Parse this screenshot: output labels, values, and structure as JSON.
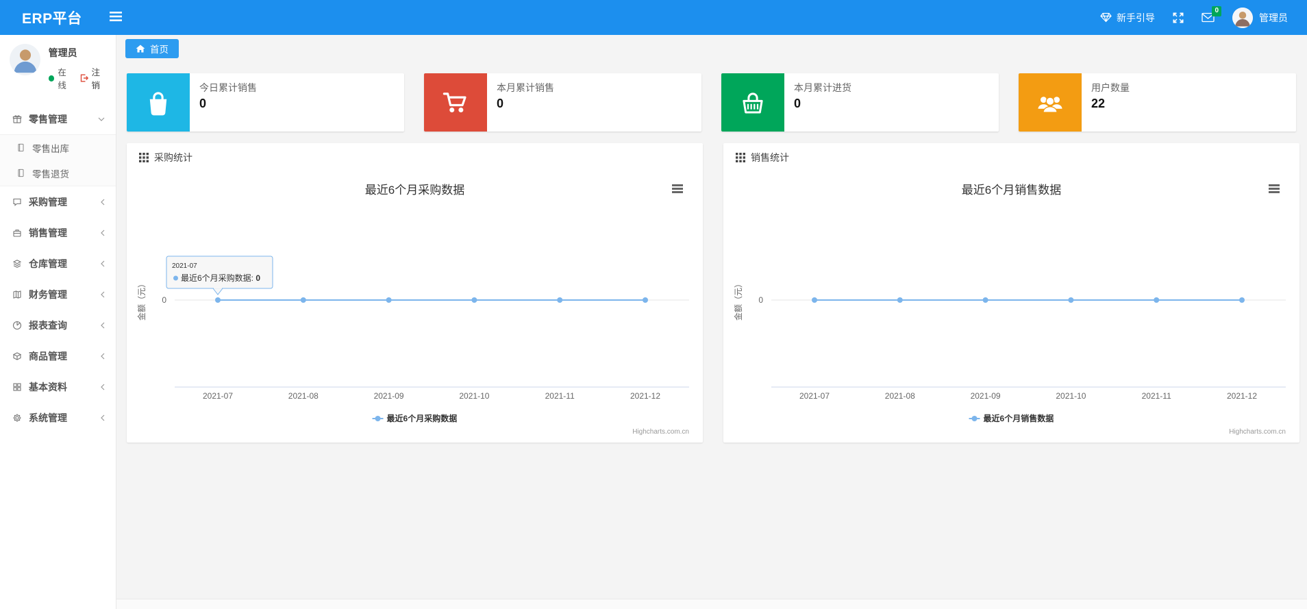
{
  "colors": {
    "navbar": "#1c8fee",
    "tab": "#2d9cf0",
    "badge": "#00a65a",
    "online": "#00a65a",
    "series": "#7cb5ec"
  },
  "navbar": {
    "brand": "ERP平台",
    "guide_label": "新手引导",
    "message_badge": "0",
    "username": "管理员"
  },
  "sidebar": {
    "user": {
      "name": "管理员",
      "status": "在线",
      "logout": "注销"
    },
    "menu": [
      {
        "label": "零售管理",
        "icon": "gift-icon",
        "expanded": true,
        "children": [
          {
            "label": "零售出库",
            "icon": "file-icon"
          },
          {
            "label": "零售退货",
            "icon": "file-icon"
          }
        ]
      },
      {
        "label": "采购管理",
        "icon": "chat-icon"
      },
      {
        "label": "销售管理",
        "icon": "briefcase-icon"
      },
      {
        "label": "仓库管理",
        "icon": "layers-icon"
      },
      {
        "label": "财务管理",
        "icon": "book-icon"
      },
      {
        "label": "报表查询",
        "icon": "pie-chart-icon"
      },
      {
        "label": "商品管理",
        "icon": "box-icon"
      },
      {
        "label": "基本资料",
        "icon": "grid-icon"
      },
      {
        "label": "系统管理",
        "icon": "gear-icon"
      }
    ]
  },
  "tabs": [
    {
      "label": "首页",
      "active": true
    }
  ],
  "stat_cards": [
    {
      "label": "今日累计销售",
      "value": "0",
      "color": "#1eb7e5",
      "icon": "bag-icon"
    },
    {
      "label": "本月累计销售",
      "value": "0",
      "color": "#dd4b39",
      "icon": "cart-icon"
    },
    {
      "label": "本月累计进货",
      "value": "0",
      "color": "#00a65a",
      "icon": "basket-icon"
    },
    {
      "label": "用户数量",
      "value": "22",
      "color": "#f39c12",
      "icon": "users-icon"
    }
  ],
  "panels": [
    {
      "header": "采购统计"
    },
    {
      "header": "销售统计"
    }
  ],
  "chart_data": [
    {
      "type": "line",
      "title": "最近6个月采购数据",
      "categories": [
        "2021-07",
        "2021-08",
        "2021-09",
        "2021-10",
        "2021-11",
        "2021-12"
      ],
      "series": [
        {
          "name": "最近6个月采购数据",
          "values": [
            0,
            0,
            0,
            0,
            0,
            0
          ],
          "color": "#7cb5ec"
        }
      ],
      "xlabel": "",
      "ylabel": "金额（元）",
      "yticks": [
        "0"
      ],
      "ylim": [
        0,
        1
      ],
      "grid": true,
      "legend_position": "bottom",
      "credits": "Highcharts.com.cn",
      "tooltip": {
        "header": "2021-07",
        "series_name": "最近6个月采购数据",
        "value": "0",
        "point_index": 0
      }
    },
    {
      "type": "line",
      "title": "最近6个月销售数据",
      "categories": [
        "2021-07",
        "2021-08",
        "2021-09",
        "2021-10",
        "2021-11",
        "2021-12"
      ],
      "series": [
        {
          "name": "最近6个月销售数据",
          "values": [
            0,
            0,
            0,
            0,
            0,
            0
          ],
          "color": "#7cb5ec"
        }
      ],
      "xlabel": "",
      "ylabel": "金额（元）",
      "yticks": [
        "0"
      ],
      "ylim": [
        0,
        1
      ],
      "grid": true,
      "legend_position": "bottom",
      "credits": "Highcharts.com.cn",
      "tooltip": null
    }
  ]
}
